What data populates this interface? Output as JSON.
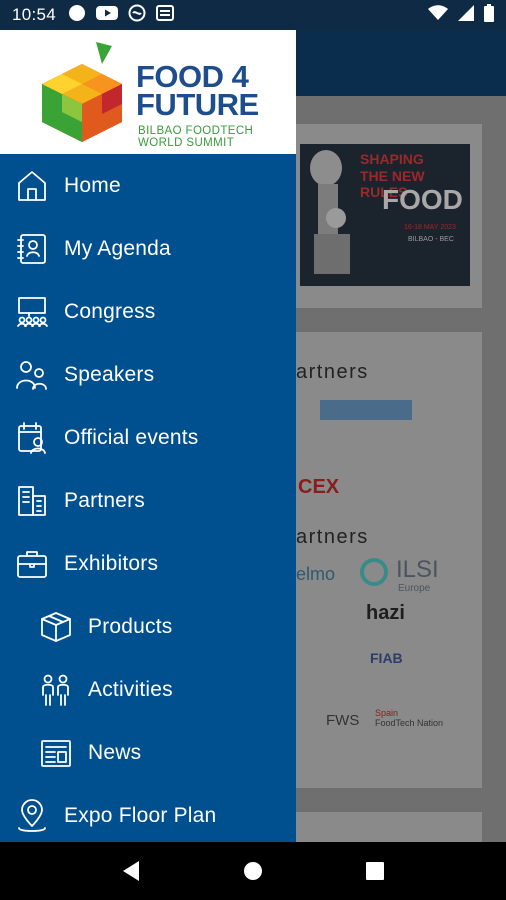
{
  "status_bar": {
    "time": "10:54",
    "left_icons": [
      "circle-icon",
      "youtube-icon",
      "do-not-disturb-icon",
      "news-icon"
    ],
    "right_icons": [
      "wifi-icon",
      "cell-signal-icon",
      "battery-icon"
    ]
  },
  "header": {
    "brand_line1": "FOOD 4",
    "brand_line2": "FUTURE",
    "tagline1": "BILBAO FOODTECH",
    "tagline2": "WORLD SUMMIT"
  },
  "menu": {
    "items": [
      {
        "label": "Home",
        "icon": "home-icon"
      },
      {
        "label": "My Agenda",
        "icon": "agenda-icon"
      },
      {
        "label": "Congress",
        "icon": "congress-icon"
      },
      {
        "label": "Speakers",
        "icon": "speakers-icon"
      },
      {
        "label": "Official events",
        "icon": "official-events-icon"
      },
      {
        "label": "Partners",
        "icon": "partners-icon"
      },
      {
        "label": "Exhibitors",
        "icon": "briefcase-icon"
      },
      {
        "label": "Products",
        "icon": "box-icon"
      },
      {
        "label": "Activities",
        "icon": "activities-icon"
      },
      {
        "label": "News",
        "icon": "newspaper-icon"
      },
      {
        "label": "Expo Floor Plan",
        "icon": "location-pin-icon"
      }
    ]
  },
  "background": {
    "banner": {
      "line1": "SHAPING",
      "line2": "THE NEW RULES",
      "line3": "FOOD",
      "line4": "16-18 MAY 2023",
      "line5": "BILBAO - BEC"
    },
    "partners_label_1": "artners",
    "partners_label_2": "artners",
    "logos": [
      "CEX",
      "elmo",
      "ILSI",
      "Europe",
      "hazi",
      "FIAB",
      "FWS",
      "Spain",
      "FoodTech Nation"
    ]
  },
  "colors": {
    "drawer": "#005090",
    "status_bar": "#0e2a44",
    "brand_blue": "#1e4d8c",
    "brand_green": "#3a9b3a"
  },
  "nav_bar": {
    "buttons": [
      "back-icon",
      "home-circle-icon",
      "recents-icon"
    ]
  }
}
